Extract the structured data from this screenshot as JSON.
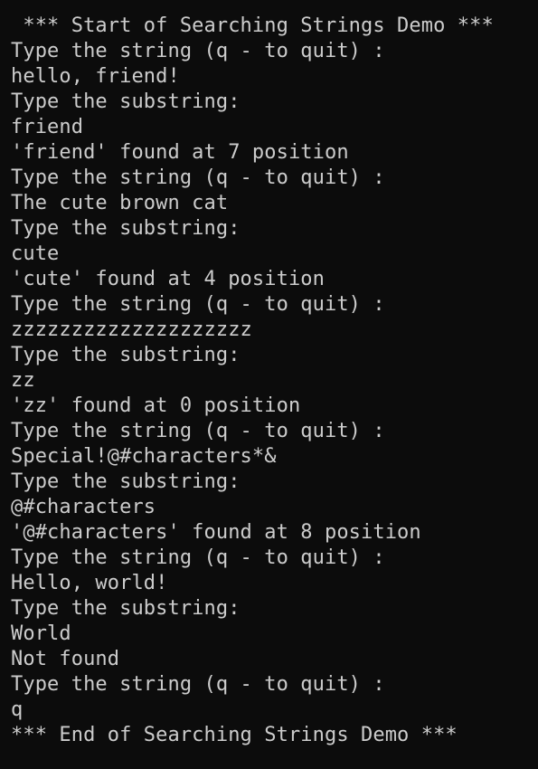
{
  "console": {
    "lines": [
      " *** Start of Searching Strings Demo ***",
      "Type the string (q - to quit) :",
      "hello, friend!",
      "Type the substring:",
      "friend",
      "'friend' found at 7 position",
      "Type the string (q - to quit) :",
      "The cute brown cat",
      "Type the substring:",
      "cute",
      "'cute' found at 4 position",
      "Type the string (q - to quit) :",
      "zzzzzzzzzzzzzzzzzzzz",
      "Type the substring:",
      "zz",
      "'zz' found at 0 position",
      "Type the string (q - to quit) :",
      "Special!@#characters*&",
      "Type the substring:",
      "@#characters",
      "'@#characters' found at 8 position",
      "Type the string (q - to quit) :",
      "Hello, world!",
      "Type the substring:",
      "World",
      "Not found",
      "Type the string (q - to quit) :",
      "q",
      "*** End of Searching Strings Demo ***"
    ]
  },
  "colors": {
    "background": "#0c0c0c",
    "text": "#cccccc"
  }
}
